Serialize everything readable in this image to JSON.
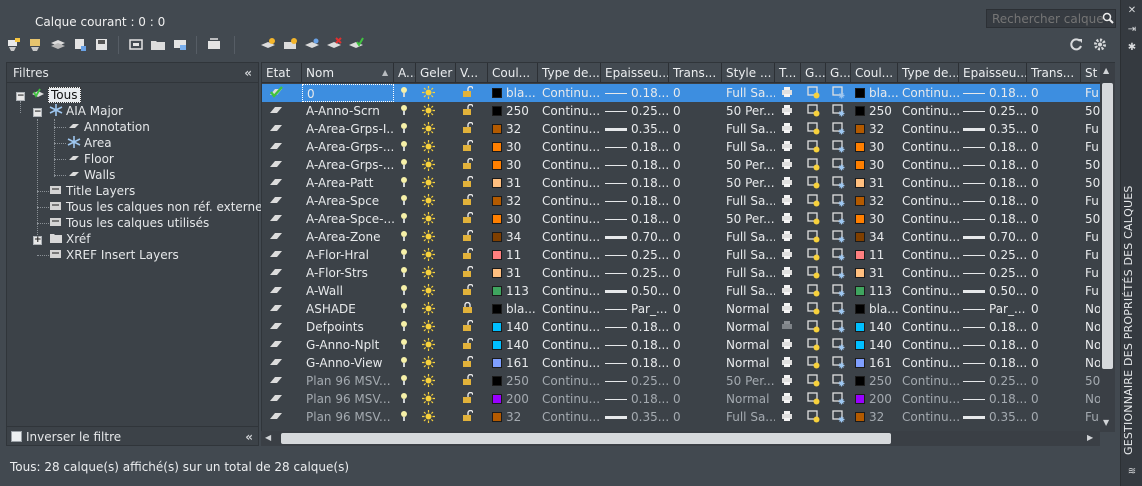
{
  "header": {
    "current_layer": "Calque courant : 0 : 0",
    "search_placeholder": "Rechercher calque",
    "side_title": "GESTIONNAIRE DES PROPRIÉTÉS DES CALQUES"
  },
  "filters": {
    "title": "Filtres",
    "collapse": "«",
    "tree": [
      "Tous",
      "AIA Major",
      "Annotation",
      "Area",
      "Floor",
      "Walls",
      "Title Layers",
      "Tous les calques non réf. externes",
      "Tous les calques utilisés",
      "Xréf",
      "XREF Insert Layers"
    ]
  },
  "invert_filter": "Inverser le filtre",
  "columns": [
    "Etat",
    "Nom",
    "A...",
    "Geler",
    "V...",
    "Coul...",
    "Type de...",
    "Epaisseu...",
    "Trans...",
    "Style ...",
    "T...",
    "G...",
    "G...",
    "Coul...",
    "Type de...",
    "Epaisseu...",
    "Trans...",
    "St"
  ],
  "rows": [
    [
      "0",
      "bla...",
      "Continu...",
      "0.18...",
      "0",
      "Full Sa...",
      "bla...",
      "Continu...",
      "0.18...",
      "0",
      "Fu",
      "#000000",
      "thin",
      "sel"
    ],
    [
      "A-Anno-Scrn",
      "250",
      "Continu...",
      "0.25...",
      "0",
      "50 Per...",
      "250",
      "Continu...",
      "0.25...",
      "0",
      "50",
      "#000000",
      "thin",
      ""
    ],
    [
      "A-Area-Grps-I...",
      "32",
      "Continu...",
      "0.35...",
      "0",
      "Full Sa...",
      "32",
      "Continu...",
      "0.35...",
      "0",
      "Fu",
      "#b35a00",
      "thick",
      ""
    ],
    [
      "A-Area-Grps-...",
      "30",
      "Continu...",
      "0.18...",
      "0",
      "Full Sa...",
      "30",
      "Continu...",
      "0.18...",
      "0",
      "Fu",
      "#ff7f00",
      "thin",
      ""
    ],
    [
      "A-Area-Grps-...",
      "30",
      "Continu...",
      "0.18...",
      "0",
      "50 Per...",
      "30",
      "Continu...",
      "0.18...",
      "0",
      "50",
      "#ff7f00",
      "thin",
      ""
    ],
    [
      "A-Area-Patt",
      "31",
      "Continu...",
      "0.18...",
      "0",
      "50 Per...",
      "31",
      "Continu...",
      "0.18...",
      "0",
      "50",
      "#ffbf7f",
      "thin",
      ""
    ],
    [
      "A-Area-Spce",
      "32",
      "Continu...",
      "0.18...",
      "0",
      "Full Sa...",
      "32",
      "Continu...",
      "0.18...",
      "0",
      "Fu",
      "#b35a00",
      "thin",
      ""
    ],
    [
      "A-Area-Spce-...",
      "30",
      "Continu...",
      "0.18...",
      "0",
      "50 Per...",
      "30",
      "Continu...",
      "0.18...",
      "0",
      "50",
      "#ff7f00",
      "thin",
      ""
    ],
    [
      "A-Area-Zone",
      "34",
      "Continu...",
      "0.70...",
      "0",
      "Full Sa...",
      "34",
      "Continu...",
      "0.70...",
      "0",
      "Fu",
      "#7f3f00",
      "thick",
      ""
    ],
    [
      "A-Flor-Hral",
      "11",
      "Continu...",
      "0.25...",
      "0",
      "Full Sa...",
      "11",
      "Continu...",
      "0.25...",
      "0",
      "Fu",
      "#ff7f7f",
      "thin",
      ""
    ],
    [
      "A-Flor-Strs",
      "31",
      "Continu...",
      "0.25...",
      "0",
      "Full Sa...",
      "31",
      "Continu...",
      "0.25...",
      "0",
      "Fu",
      "#ffbf7f",
      "thin",
      ""
    ],
    [
      "A-Wall",
      "113",
      "Continu...",
      "0.50...",
      "0",
      "Full Sa...",
      "113",
      "Continu...",
      "0.50...",
      "0",
      "Fu",
      "#3fa55f",
      "thick",
      ""
    ],
    [
      "ASHADE",
      "bla...",
      "Continu...",
      "Par_...",
      "0",
      "Normal",
      "bla...",
      "Continu...",
      "Par_...",
      "0",
      "No",
      "#000000",
      "thin",
      ""
    ],
    [
      "Defpoints",
      "140",
      "Continu...",
      "0.18...",
      "0",
      "Normal",
      "140",
      "Continu...",
      "0.18...",
      "0",
      "No",
      "#00bfff",
      "thin",
      ""
    ],
    [
      "G-Anno-Nplt",
      "140",
      "Continu...",
      "0.18...",
      "0",
      "Normal",
      "140",
      "Continu...",
      "0.18...",
      "0",
      "No",
      "#00bfff",
      "thin",
      ""
    ],
    [
      "G-Anno-View",
      "161",
      "Continu...",
      "0.18...",
      "0",
      "Normal",
      "161",
      "Continu...",
      "0.18...",
      "0",
      "No",
      "#7f9fff",
      "thin",
      ""
    ],
    [
      "Plan 96 MSV...",
      "250",
      "Continu...",
      "0.25...",
      "0",
      "50 Per...",
      "250",
      "Continu...",
      "0.25...",
      "0",
      "50",
      "#000000",
      "thin",
      "dim"
    ],
    [
      "Plan 96 MSV...",
      "200",
      "Continu...",
      "0.18...",
      "0",
      "Normal",
      "200",
      "Continu...",
      "0.18...",
      "0",
      "No",
      "#9900ff",
      "thin",
      "dim"
    ],
    [
      "Plan 96 MSV...",
      "32",
      "Continu...",
      "0.35...",
      "0",
      "Full Sa...",
      "32",
      "Continu...",
      "0.35...",
      "0",
      "Fu",
      "#b35a00",
      "thick",
      "dim"
    ]
  ],
  "status": "Tous: 28 calque(s) affiché(s) sur un total de 28 calque(s)"
}
